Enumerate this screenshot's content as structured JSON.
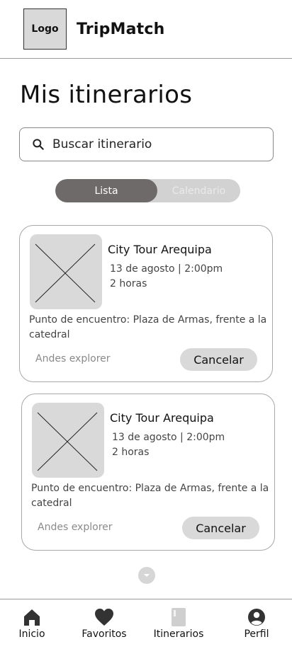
{
  "header": {
    "logo_text": "Logo",
    "app_name": "TripMatch"
  },
  "page": {
    "title": "Mis itinerarios"
  },
  "search": {
    "placeholder": "Buscar itinerario"
  },
  "view_toggle": {
    "options": [
      "Lista",
      "Calendario"
    ],
    "selected": "Lista"
  },
  "itineraries": [
    {
      "title": "City Tour Arequipa",
      "date": "13 de agosto | 2:00pm",
      "duration": "2 horas",
      "meeting_point": "Punto de encuentro: Plaza de Armas, frente a la catedral",
      "agency": "Andes explorer",
      "cancel_label": "Cancelar"
    },
    {
      "title": "City Tour Arequipa",
      "date": "13 de agosto | 2:00pm",
      "duration": "2 horas",
      "meeting_point": "Punto de encuentro: Plaza de Armas, frente a la catedral",
      "agency": "Andes explorer",
      "cancel_label": "Cancelar"
    }
  ],
  "bottom_nav": {
    "items": [
      {
        "label": "Inicio",
        "icon": "home-icon"
      },
      {
        "label": "Favoritos",
        "icon": "heart-icon"
      },
      {
        "label": "Itinerarios",
        "icon": "book-icon"
      },
      {
        "label": "Perfil",
        "icon": "user-icon"
      }
    ]
  },
  "colors": {
    "accent_toggle": "#6e6a6a",
    "placeholder_fill": "#d9d9d9",
    "border": "#a8a8a8"
  }
}
